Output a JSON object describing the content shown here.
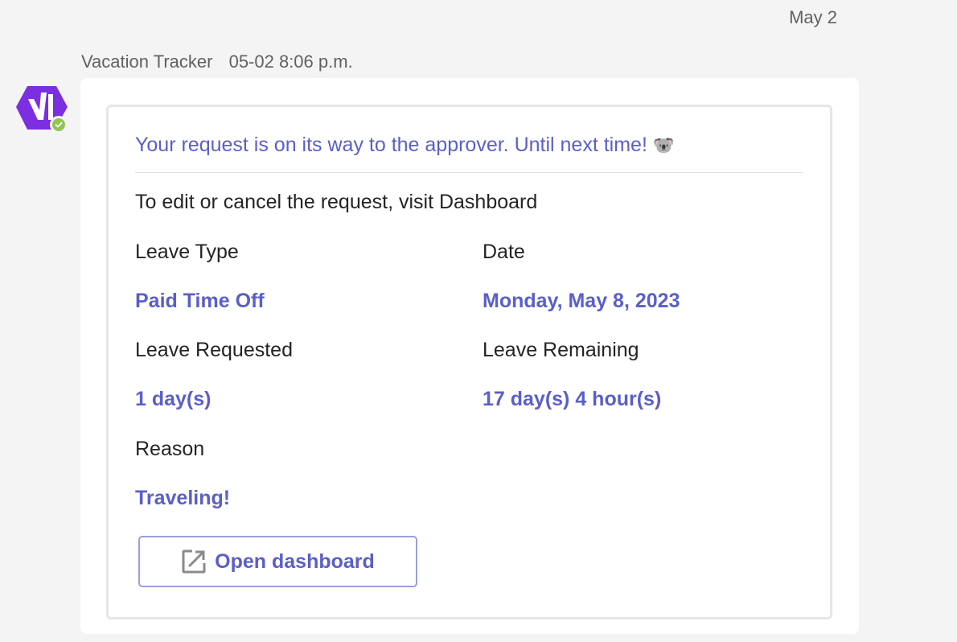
{
  "chat": {
    "date_divider": "May 2",
    "message": {
      "sender": "Vacation Tracker",
      "timestamp": "05-02 8:06 p.m.",
      "avatar": {
        "icon": "vacation-tracker-logo-icon",
        "brand_color": "#7b2fe0",
        "presence": "available",
        "presence_color": "#92c353"
      }
    }
  },
  "card": {
    "headline": "Your request is on its way to the approver. Until next time!",
    "headline_emoji": "🐨",
    "instructions": "To edit or cancel the request, visit Dashboard",
    "facts": {
      "leave_type": {
        "label": "Leave Type",
        "value": "Paid Time Off"
      },
      "date": {
        "label": "Date",
        "value": "Monday, May 8, 2023"
      },
      "leave_requested": {
        "label": "Leave Requested",
        "value": "1 day(s)"
      },
      "leave_remaining": {
        "label": "Leave Remaining",
        "value": "17 day(s) 4 hour(s)"
      },
      "reason": {
        "label": "Reason",
        "value": "Traveling!"
      }
    },
    "action": {
      "label": "Open dashboard",
      "icon": "open-external-icon"
    },
    "accent_color": "#5b5fc7"
  }
}
